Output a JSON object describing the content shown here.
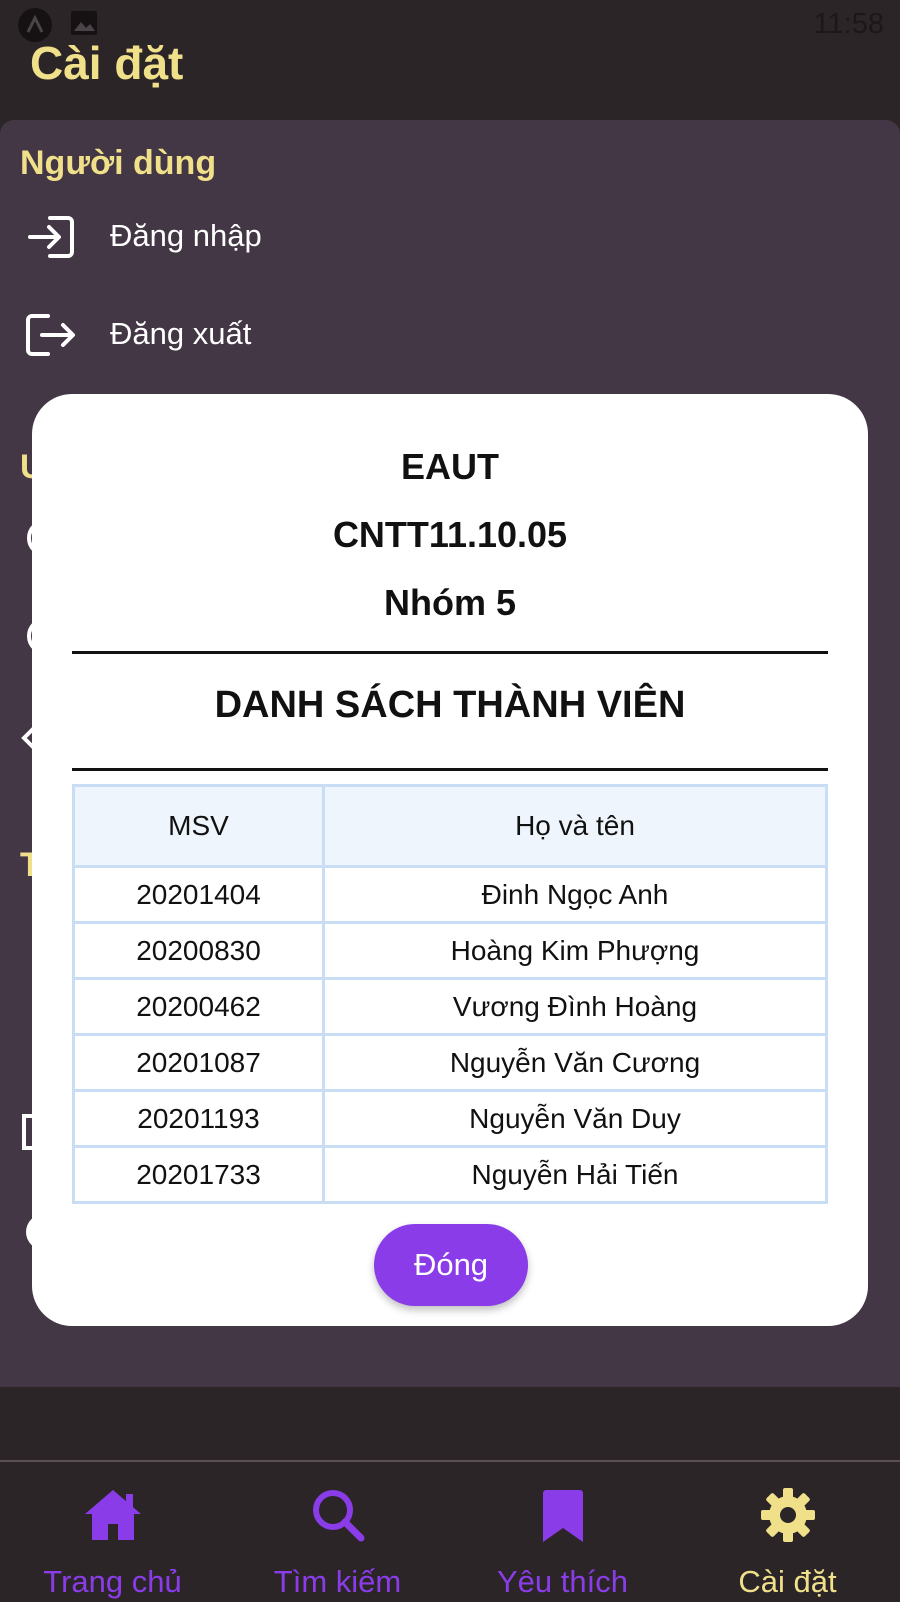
{
  "status_bar": {
    "time": "11:58"
  },
  "header": {
    "title": "Cài đặt"
  },
  "settings": {
    "user_section_title": "Người dùng",
    "items": [
      {
        "label": "Đăng nhập",
        "icon": "login-icon"
      },
      {
        "label": "Đăng xuất",
        "icon": "logout-icon"
      }
    ]
  },
  "modal": {
    "line1": "EAUT",
    "line2": "CNTT11.10.05",
    "line3": "Nhóm 5",
    "heading": "DANH SÁCH THÀNH VIÊN",
    "columns": [
      "MSV",
      "Họ và tên"
    ],
    "rows": [
      [
        "20201404",
        "Đinh Ngọc Anh"
      ],
      [
        "20200830",
        "Hoàng Kim Phượng"
      ],
      [
        "20200462",
        "Vương Đình Hoàng"
      ],
      [
        "20201087",
        "Nguyễn Văn Cương"
      ],
      [
        "20201193",
        "Nguyễn Văn Duy"
      ],
      [
        "20201733",
        "Nguyễn Hải Tiến"
      ]
    ],
    "close_label": "Đóng"
  },
  "nav": {
    "items": [
      {
        "label": "Trang chủ",
        "icon": "home-icon",
        "active": false
      },
      {
        "label": "Tìm kiếm",
        "icon": "search-icon",
        "active": false
      },
      {
        "label": "Yêu thích",
        "icon": "bookmark-icon",
        "active": false
      },
      {
        "label": "Cài đặt",
        "icon": "gear-icon",
        "active": true
      }
    ],
    "colors": {
      "inactive": "#8a3ce8",
      "active": "#f0e08a"
    }
  },
  "colors": {
    "accent_yellow": "#f0e08a",
    "accent_purple": "#8a3ce8",
    "card_bg": "#433645",
    "screen_bg": "#2b2528"
  }
}
